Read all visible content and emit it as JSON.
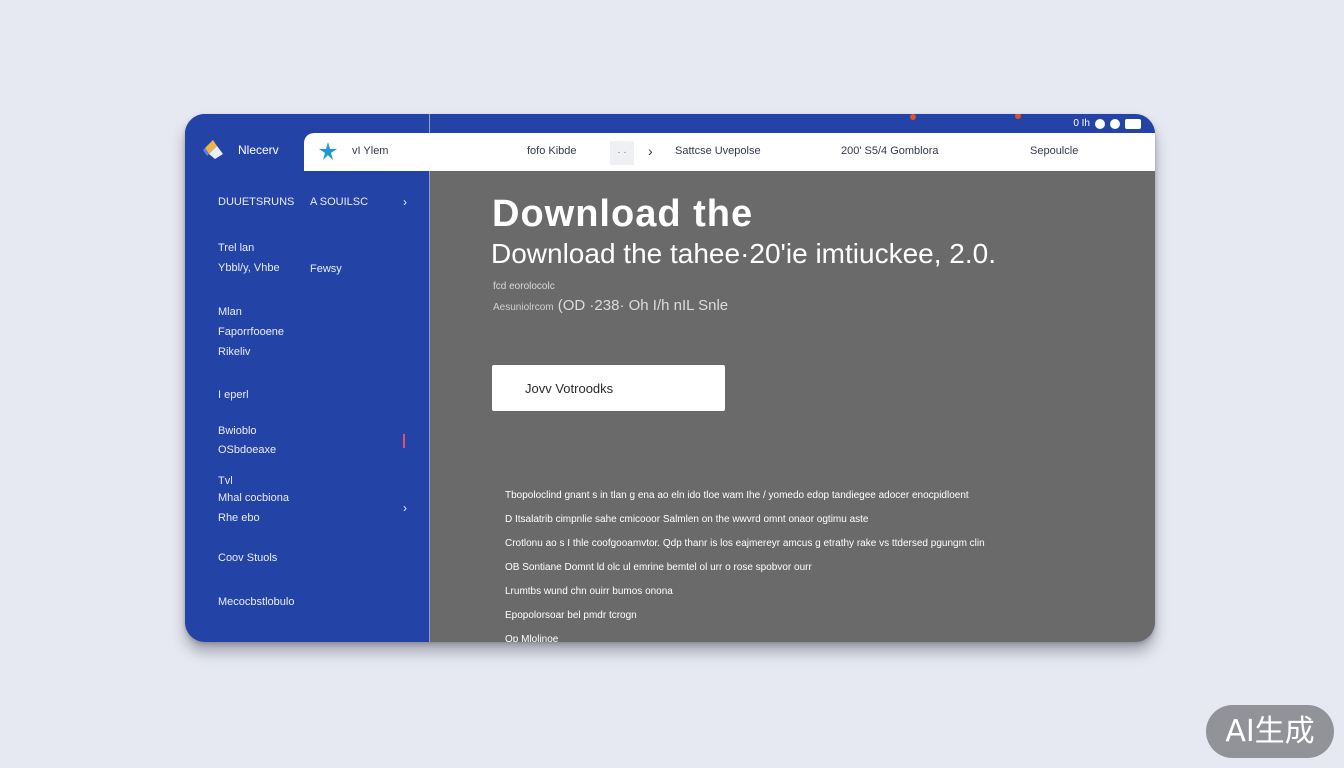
{
  "window": {
    "app_name": "Nlecerv",
    "status_text": "0 Ih"
  },
  "header": {
    "brand": "vI Ylem",
    "items": [
      "fofo Kibde",
      "Sattcse Uvepolse",
      "200' S5/4 Gomblora",
      "Sepoulcle"
    ],
    "box_label": "· ·"
  },
  "sidebar": {
    "items": [
      {
        "label": "DUUETSRUNS"
      },
      {
        "label": "Trel lan"
      },
      {
        "label": "Ybbl/y, Vhbe"
      },
      {
        "label": "Mlan"
      },
      {
        "label": "Faporrfooene"
      },
      {
        "label": "Rikeliv"
      },
      {
        "label": "I eperl"
      },
      {
        "label": "Bwioblo"
      },
      {
        "label": "OSbdoeaxe"
      },
      {
        "label": "Tvl"
      },
      {
        "label": "Mhal cocbiona"
      },
      {
        "label": "Rhe ebo"
      },
      {
        "label": "Coov Stuols"
      },
      {
        "label": "Mecocbstlobulo"
      }
    ],
    "sub_labels": [
      "A  SOUILSC",
      "Fewsy"
    ]
  },
  "main": {
    "title": "Download the",
    "subtitle": "Download the tahee·20'ie imtiuckee, 2.0.",
    "meta_line1": "fcd  eorolocolc",
    "meta_line2_small": "Aesuniolrcom",
    "meta_line2_large": "(OD  ·238·  Oh I/h nIL Snle",
    "download_button": "Jovv Votroodks",
    "body_lines": [
      "Tbopoloclind gnant s in tlan g ena ao eln ido tloe wam Ihe / yomedo edop tandiegee adocer enocpidloent",
      "D  Itsalatrib  cimpnlie  sahe  cmicooor  Salmlen on  the wwvrd omnt  onaor ogtimu aste",
      "Crotlonu ao  s I thle  coofgooamvtor.  Qdp  thanr  is  los  eajmereyr  amcus  g  etrathy  rake vs  ttdersed  pgungm clin",
      "OB  Sontiane  Domnt ld olc  ul  emrine  bemtel ol urr o  rose  spobvor ourr",
      "Lrumtbs  wund chn ouirr  bumos  onona",
      "Epopolorsoar bel pmdr tcrogn",
      "Op  Mlolinoe"
    ]
  },
  "watermark": "AI生成",
  "colors": {
    "sidebar": "#2443a6",
    "content": "#6a6a6a",
    "page_bg": "#e6e9f2",
    "accent_orange": "#e0532c",
    "star_blue": "#2196d8",
    "star_teal": "#13a089"
  },
  "icons": [
    "logo-icon",
    "star-icon",
    "chevron-right-icon",
    "battery-icon"
  ]
}
